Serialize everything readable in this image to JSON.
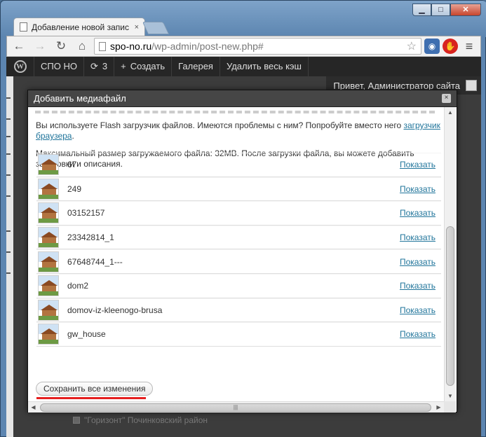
{
  "window": {
    "controls": {
      "minimize": "▁",
      "maximize": "□",
      "close": "✕"
    }
  },
  "tab": {
    "title": "Добавление новой запис",
    "close": "×"
  },
  "toolbar": {
    "back": "←",
    "forward": "→",
    "reload": "↻",
    "home": "⌂",
    "url_host": "spo-no.ru",
    "url_path": "/wp-admin/post-new.php#",
    "star": "☆",
    "ext_camera": "◉",
    "ext_stop": "✋",
    "menu": "≡"
  },
  "adminbar": {
    "wp_logo": "W",
    "site": "СПО НО",
    "updates_icon": "⟳",
    "updates_count": "3",
    "create_icon": "+",
    "create": "Создать",
    "gallery": "Галерея",
    "clear_cache": "Удалить весь кэш",
    "greeting": "Привет, Администратор сайта"
  },
  "modal": {
    "title": "Добавить медиафайл",
    "close": "×",
    "flash_note_prefix": "Вы используете Flash загрузчик файлов. Имеются проблемы с ним? Попробуйте вместо него ",
    "flash_note_link": "загрузчик браузера",
    "flash_note_suffix": ".",
    "size_note": "Максимальный размер загружаемого файла: 32MB. После загрузки файла, вы можете добавить заголовки и описания.",
    "files": [
      {
        "name": "67",
        "action": "Показать"
      },
      {
        "name": "249",
        "action": "Показать"
      },
      {
        "name": "03152157",
        "action": "Показать"
      },
      {
        "name": "23342814_1",
        "action": "Показать"
      },
      {
        "name": "67648744_1---",
        "action": "Показать"
      },
      {
        "name": "dom2",
        "action": "Показать"
      },
      {
        "name": "domov-iz-kleenogo-brusa",
        "action": "Показать"
      },
      {
        "name": "gw_house",
        "action": "Показать"
      }
    ],
    "save_button": "Сохранить все изменения",
    "hscroll_grip": "|||",
    "arrows": {
      "up": "▲",
      "down": "▼",
      "left": "◀",
      "right": "▶"
    }
  },
  "background": {
    "bottom_item": "\"Горизонт\" Починковский район"
  },
  "colors": {
    "link": "#21759b",
    "highlight_underline": "#e51f1f",
    "adminbar": "#262626"
  }
}
